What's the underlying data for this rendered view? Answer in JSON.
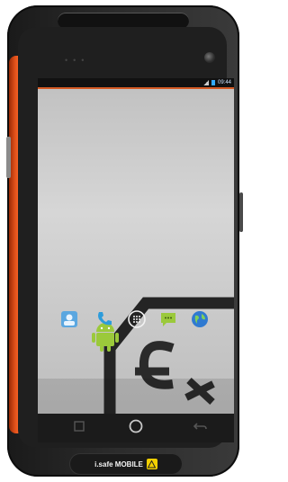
{
  "status_bar": {
    "time": "09:44"
  },
  "brand": {
    "name": "i.safe MOBILE"
  },
  "dock": {
    "items": [
      {
        "name": "contacts-icon"
      },
      {
        "name": "phone-icon"
      },
      {
        "name": "apps-drawer-icon"
      },
      {
        "name": "messaging-icon"
      },
      {
        "name": "browser-icon"
      }
    ]
  },
  "colors": {
    "accent_orange": "#e0501a",
    "android_green": "#9bc93b",
    "status_blue": "#33aaff"
  }
}
